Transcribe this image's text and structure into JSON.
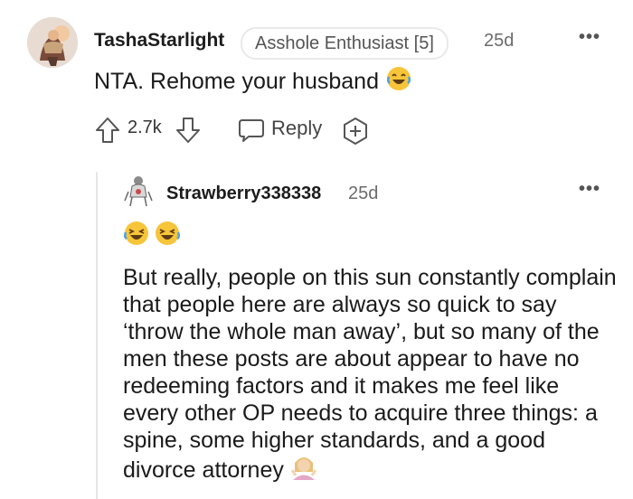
{
  "top_comment": {
    "username": "TashaStarlight",
    "flair": "Asshole Enthusiast [5]",
    "time": "25d",
    "body": "NTA. Rehome your husband",
    "score": "2.7k",
    "reply_label": "Reply",
    "more": "•••"
  },
  "reply_comment": {
    "username": "Strawberry338338",
    "time": "25d",
    "more": "•••",
    "body": "But really, people on this sun constantly complain that people here are always so quick to say ‘throw the whole man away’, but so many of the men these posts are about appear to have no redeeming factors and it makes me feel like every other OP needs to acquire three things: a spine, some higher standards, and a good divorce attorney"
  },
  "icons": {
    "upvote": "upvote-icon",
    "downvote": "downvote-icon",
    "reply": "reply-bubble-icon",
    "award": "award-plus-icon",
    "laughing_emoji": "laughing-emoji-icon",
    "shrug_emoji": "woman-shrugging-emoji-icon"
  },
  "colors": {
    "text": "#1a1a1b",
    "meta": "#6b6b6b",
    "thread_line": "#e6e6e6",
    "emoji_face": "#f7c53a"
  }
}
